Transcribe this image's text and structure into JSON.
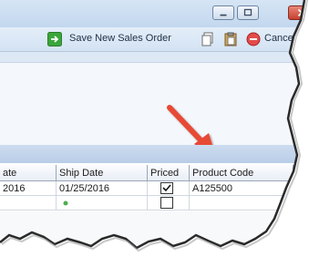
{
  "window": {
    "minimize_label": "minimize",
    "maximize_label": "maximize",
    "close_label": "close"
  },
  "toolbar": {
    "save_new_sales_order_label": "Save New Sales Order",
    "cancel_label": "Cancel",
    "icons": [
      "save-arrow-icon",
      "copy-icon",
      "paste-icon",
      "cancel-icon"
    ]
  },
  "grid": {
    "columns": [
      "ate",
      "Ship Date",
      "Priced",
      "Product Code"
    ],
    "rows": [
      {
        "order_date": "2016",
        "ship_date": "01/25/2016",
        "priced": true,
        "product_code": "A125500"
      },
      {
        "order_date": "",
        "ship_date": "",
        "priced": false,
        "product_code": ""
      }
    ]
  },
  "annotation": {
    "arrow_color": "#e74a35"
  }
}
